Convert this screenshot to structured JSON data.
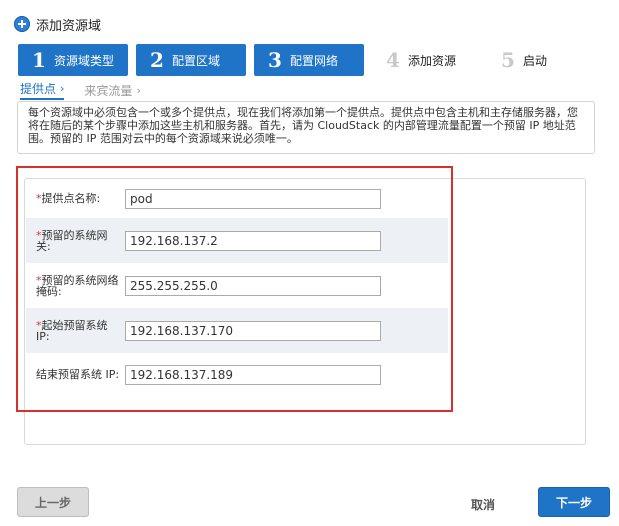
{
  "dialog": {
    "title": "添加资源域"
  },
  "steps": [
    {
      "num": "1",
      "label": "资源域类型",
      "state": "active"
    },
    {
      "num": "2",
      "label": "配置区域",
      "state": "active"
    },
    {
      "num": "3",
      "label": "配置网络",
      "state": "active"
    },
    {
      "num": "4",
      "label": "添加资源",
      "state": "inactive"
    },
    {
      "num": "5",
      "label": "启动",
      "state": "inactive"
    }
  ],
  "subtabs": [
    {
      "label": "提供点",
      "chev": "›"
    },
    {
      "label": "来宾流量",
      "chev": "›"
    }
  ],
  "description": "每个资源域中必须包含一个或多个提供点，现在我们将添加第一个提供点。提供点中包含主机和主存储服务器，您将在随后的某个步骤中添加这些主机和服务器。首先，请为 CloudStack 的内部管理流量配置一个预留 IP 地址范围。预留的 IP 范围对云中的每个资源域来说必须唯一。",
  "form": {
    "fields": [
      {
        "label": "提供点名称:",
        "required": true,
        "value": "pod"
      },
      {
        "label": "预留的系统网关:",
        "required": true,
        "value": "192.168.137.2"
      },
      {
        "label": "预留的系统网络掩码:",
        "required": true,
        "value": "255.255.255.0"
      },
      {
        "label": "起始预留系统 IP:",
        "required": true,
        "value": "192.168.137.170"
      },
      {
        "label": "结束预留系统 IP:",
        "required": false,
        "value": "192.168.137.189"
      }
    ],
    "required_mark": "*"
  },
  "buttons": {
    "prev": "上一步",
    "cancel": "取消",
    "next": "下一步"
  },
  "colors": {
    "accent": "#1f74c8",
    "highlight": "#d9302c",
    "required": "#e03232",
    "row_alt": "#edf0f5"
  }
}
